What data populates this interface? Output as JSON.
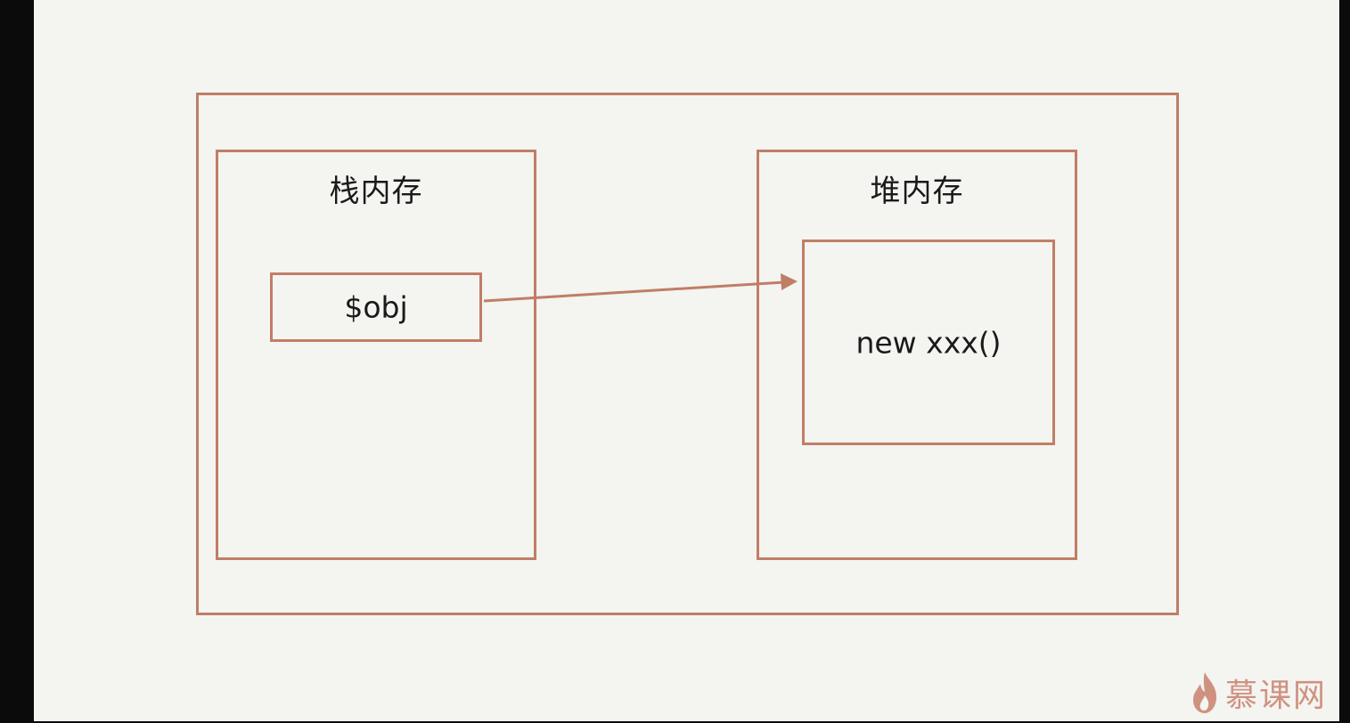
{
  "diagram": {
    "stack": {
      "label": "栈内存"
    },
    "heap": {
      "label": "堆内存"
    },
    "variable": {
      "label": "$obj"
    },
    "instance": {
      "label": "new xxx()"
    }
  },
  "watermark": {
    "text": "慕课网"
  },
  "colors": {
    "border": "#c07e66",
    "background": "#f4f4f1",
    "frame": "#0b0b0b",
    "watermark": "#c9826e"
  }
}
